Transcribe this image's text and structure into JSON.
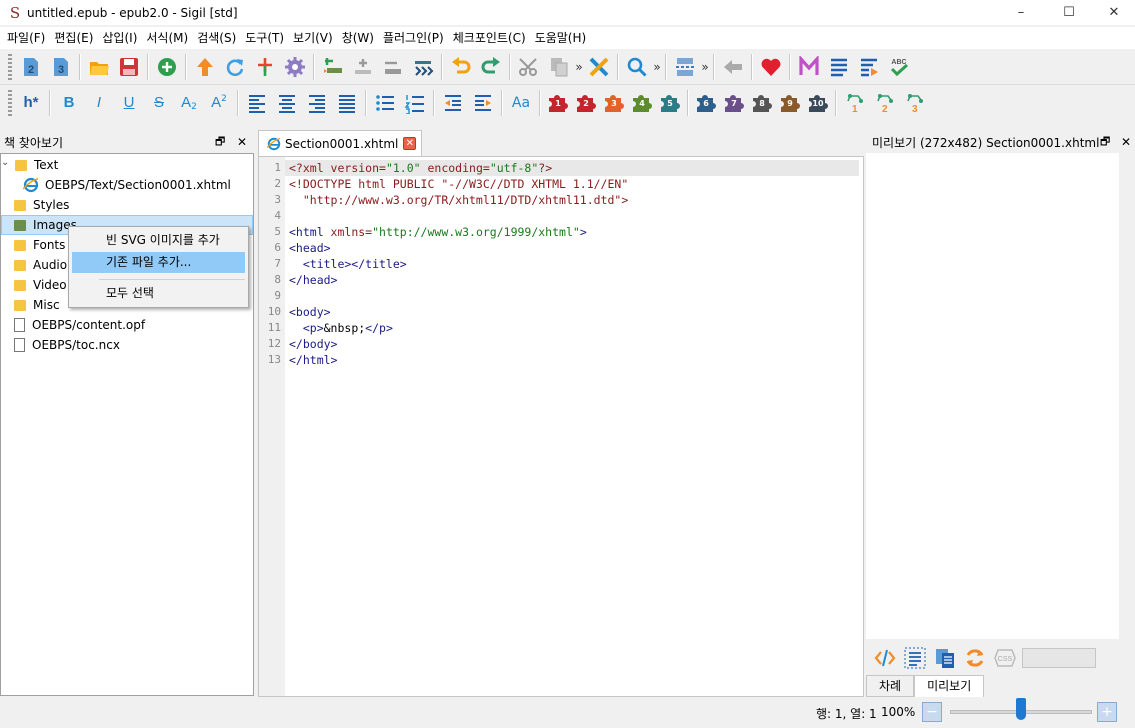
{
  "window": {
    "title": "untitled.epub - epub2.0 - Sigil [std]",
    "app_icon_glyph": "S",
    "controls": {
      "minimize": "–",
      "maximize": "☐",
      "close": "✕"
    }
  },
  "menu": [
    "파일(F)",
    "편집(E)",
    "삽입(I)",
    "서식(M)",
    "검색(S)",
    "도구(T)",
    "보기(V)",
    "창(W)",
    "플러그인(P)",
    "체크포인트(C)",
    "도움말(H)"
  ],
  "toolbar2_text": {
    "heading": "h*",
    "bold": "B",
    "italic": "I",
    "underline": "U",
    "strike": "S",
    "subscript": "A",
    "superscript": "A",
    "case": "Aa"
  },
  "plugins": [
    "1",
    "2",
    "3",
    "4",
    "5",
    "6",
    "7",
    "8",
    "9",
    "10"
  ],
  "clipboard": [
    "1",
    "2",
    "3"
  ],
  "more_glyph": "»",
  "book_browser": {
    "title": "책 찾아보기",
    "float_glyph": "🗗",
    "close_glyph": "✕",
    "items": [
      {
        "label": "Text",
        "kind": "folder",
        "expanded": true
      },
      {
        "label": "OEBPS/Text/Section0001.xhtml",
        "kind": "xhtml"
      },
      {
        "label": "Styles",
        "kind": "folder"
      },
      {
        "label": "Images",
        "kind": "folder",
        "selected": true
      },
      {
        "label": "Fonts",
        "kind": "folder"
      },
      {
        "label": "Audio",
        "kind": "folder"
      },
      {
        "label": "Video",
        "kind": "folder"
      },
      {
        "label": "Misc",
        "kind": "folder"
      },
      {
        "label": "OEBPS/content.opf",
        "kind": "file"
      },
      {
        "label": "OEBPS/toc.ncx",
        "kind": "file"
      }
    ],
    "expand_glyph": "⌄"
  },
  "context_menu": {
    "items": [
      "빈 SVG 이미지를 추가",
      "기존 파일 추가...",
      "모두 선택"
    ]
  },
  "editor": {
    "tab_label": "Section0001.xhtml",
    "tab_close": "✕",
    "line_numbers": [
      "1",
      "2",
      "3",
      "4",
      "5",
      "6",
      "7",
      "8",
      "9",
      "10",
      "11",
      "12",
      "13"
    ],
    "code": {
      "l1a": "<?xml ",
      "l1b": "version=",
      "l1c": "\"1.0\"",
      "l1d": " encoding=",
      "l1e": "\"utf-8\"",
      "l1f": "?>",
      "l2a": "<!DOCTYPE html PUBLIC \"-//W3C//DTD XHTML 1.1//EN\"",
      "l3a": "  \"http://www.w3.org/TR/xhtml11/DTD/xhtml11.dtd\">",
      "l5a": "<html ",
      "l5b": "xmlns=",
      "l5c": "\"http://www.w3.org/1999/xhtml\"",
      "l5d": ">",
      "l6a": "<head>",
      "l7a": "  <title></title>",
      "l8a": "</head>",
      "l10a": "<body>",
      "l11a": "  <p>",
      "l11b": "&nbsp;",
      "l11c": "</p>",
      "l12a": "</body>",
      "l13a": "</html>"
    }
  },
  "preview": {
    "title": "미리보기 (272x482) Section0001.xhtml",
    "float_glyph": "🗗",
    "close_glyph": "✕",
    "css_label": "CSS",
    "tabs": [
      "차례",
      "미리보기"
    ],
    "active_tab": 1
  },
  "status": {
    "position": "행: 1, 열: 1",
    "zoom": "100%",
    "zoom_fraction": 0.5,
    "zoom_out": "−",
    "zoom_in": "+"
  },
  "colors": {
    "puzzle_red": "#c0262b",
    "puzzle_green": "#5c8c2e",
    "puzzle_teal": "#2a7d86",
    "puzzle_blue": "#2e5f8a",
    "puzzle_brown": "#8a5a2b",
    "puzzle_gray": "#555555"
  }
}
